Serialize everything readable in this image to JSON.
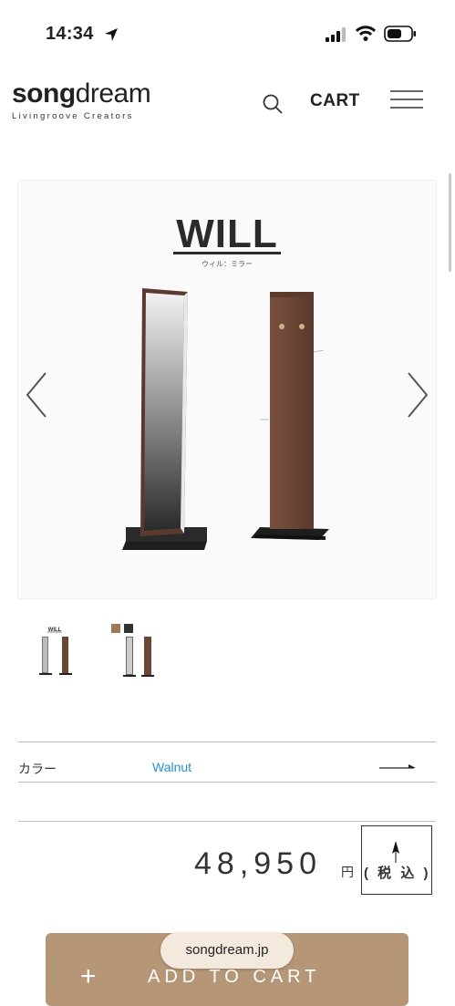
{
  "status_bar": {
    "time": "14:34",
    "icons": [
      "location-arrow-icon",
      "signal-icon",
      "wifi-icon",
      "battery-icon"
    ]
  },
  "header": {
    "logo_bold": "song",
    "logo_thin": "dream",
    "tagline": "Livingroove Creators",
    "cart_label": "CART",
    "icons": [
      "search-icon",
      "hamburger-menu-icon"
    ]
  },
  "product_image": {
    "title": "WILL",
    "subtitle": "ウィル：ミラー",
    "nav_icons": [
      "chevron-left-icon",
      "chevron-right-icon"
    ]
  },
  "thumbnails": [
    {
      "name": "WILL"
    },
    {
      "name": ""
    }
  ],
  "options": {
    "color_label": "カラー",
    "color_value": "Walnut"
  },
  "price": {
    "amount": "48,950",
    "currency": "円",
    "tax_note": "( 税 込 )"
  },
  "add_to_cart": {
    "plus": "+",
    "label": "ADD TO CART"
  },
  "browser": {
    "domain": "songdream.jp"
  },
  "colors": {
    "accent_button": "#b59676",
    "link_blue": "#2a8fd8",
    "walnut": "#6b4535"
  }
}
